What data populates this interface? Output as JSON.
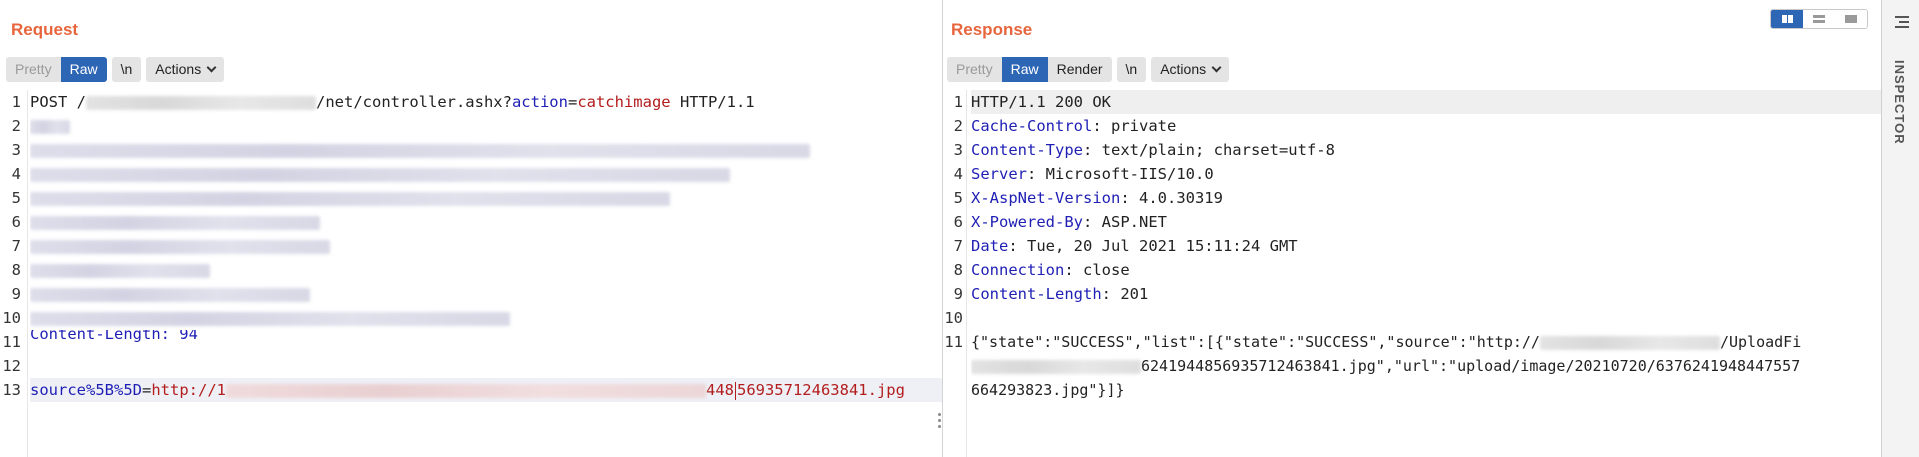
{
  "request": {
    "title": "Request",
    "toolbar": {
      "pretty": "Pretty",
      "raw": "Raw",
      "newline": "\\n",
      "actions": "Actions"
    },
    "line_numbers": [
      "1",
      "2",
      "3",
      "4",
      "5",
      "6",
      "7",
      "8",
      "9",
      "10",
      "11",
      "12",
      "13"
    ],
    "line1": {
      "method": "POST /",
      "path": "/net/controller.ashx?",
      "param": "action",
      "eq": "=",
      "value": "catchimage",
      "proto": " HTTP/1.1"
    },
    "line11": "Content-Length: 94",
    "line13": {
      "key": "source%5B%5D",
      "eq": "=",
      "url_start": "http://1",
      "url_mid": "448",
      "url_end": "56935712463841.jpg"
    }
  },
  "response": {
    "title": "Response",
    "toolbar": {
      "pretty": "Pretty",
      "raw": "Raw",
      "render": "Render",
      "newline": "\\n",
      "actions": "Actions"
    },
    "line_numbers": [
      "1",
      "2",
      "3",
      "4",
      "5",
      "6",
      "7",
      "8",
      "9",
      "10",
      "11"
    ],
    "status_line": "HTTP/1.1 200 OK",
    "headers": [
      {
        "name": "Cache-Control",
        "value": " private"
      },
      {
        "name": "Content-Type",
        "value": " text/plain; charset=utf-8"
      },
      {
        "name": "Server",
        "value": " Microsoft-IIS/10.0"
      },
      {
        "name": "X-AspNet-Version",
        "value": " 4.0.30319"
      },
      {
        "name": "X-Powered-By",
        "value": " ASP.NET"
      },
      {
        "name": "Date",
        "value": " Tue, 20 Jul 2021 15:11:24 GMT"
      },
      {
        "name": "Connection",
        "value": " close"
      },
      {
        "name": "Content-Length",
        "value": " 201"
      }
    ],
    "body_part1": "{\"state\":\"SUCCESS\",\"list\":[{\"state\":\"SUCCESS\",\"source\":\"http://",
    "body_part2": "/UploadFi",
    "body_part3": "6241944856935712463841.jpg\",\"url\":\"upload/image/20210720/6376241948447557",
    "body_part4": "664293823.jpg\"}]}"
  },
  "inspector": {
    "label": "INSPECTOR"
  },
  "colors": {
    "accent": "#e8663d",
    "active_button": "#2d66b5",
    "key_blue": "#1f1fb5",
    "value_red": "#b31d1d"
  }
}
